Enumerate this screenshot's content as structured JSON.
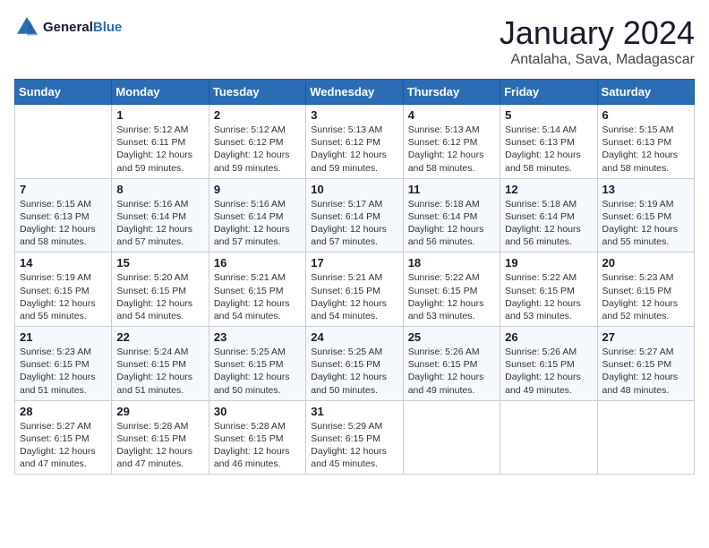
{
  "logo": {
    "line1": "General",
    "line2": "Blue"
  },
  "calendar": {
    "title": "January 2024",
    "subtitle": "Antalaha, Sava, Madagascar",
    "headers": [
      "Sunday",
      "Monday",
      "Tuesday",
      "Wednesday",
      "Thursday",
      "Friday",
      "Saturday"
    ],
    "weeks": [
      [
        {
          "day": "",
          "info": ""
        },
        {
          "day": "1",
          "info": "Sunrise: 5:12 AM\nSunset: 6:11 PM\nDaylight: 12 hours\nand 59 minutes."
        },
        {
          "day": "2",
          "info": "Sunrise: 5:12 AM\nSunset: 6:12 PM\nDaylight: 12 hours\nand 59 minutes."
        },
        {
          "day": "3",
          "info": "Sunrise: 5:13 AM\nSunset: 6:12 PM\nDaylight: 12 hours\nand 59 minutes."
        },
        {
          "day": "4",
          "info": "Sunrise: 5:13 AM\nSunset: 6:12 PM\nDaylight: 12 hours\nand 58 minutes."
        },
        {
          "day": "5",
          "info": "Sunrise: 5:14 AM\nSunset: 6:13 PM\nDaylight: 12 hours\nand 58 minutes."
        },
        {
          "day": "6",
          "info": "Sunrise: 5:15 AM\nSunset: 6:13 PM\nDaylight: 12 hours\nand 58 minutes."
        }
      ],
      [
        {
          "day": "7",
          "info": "Sunrise: 5:15 AM\nSunset: 6:13 PM\nDaylight: 12 hours\nand 58 minutes."
        },
        {
          "day": "8",
          "info": "Sunrise: 5:16 AM\nSunset: 6:14 PM\nDaylight: 12 hours\nand 57 minutes."
        },
        {
          "day": "9",
          "info": "Sunrise: 5:16 AM\nSunset: 6:14 PM\nDaylight: 12 hours\nand 57 minutes."
        },
        {
          "day": "10",
          "info": "Sunrise: 5:17 AM\nSunset: 6:14 PM\nDaylight: 12 hours\nand 57 minutes."
        },
        {
          "day": "11",
          "info": "Sunrise: 5:18 AM\nSunset: 6:14 PM\nDaylight: 12 hours\nand 56 minutes."
        },
        {
          "day": "12",
          "info": "Sunrise: 5:18 AM\nSunset: 6:14 PM\nDaylight: 12 hours\nand 56 minutes."
        },
        {
          "day": "13",
          "info": "Sunrise: 5:19 AM\nSunset: 6:15 PM\nDaylight: 12 hours\nand 55 minutes."
        }
      ],
      [
        {
          "day": "14",
          "info": "Sunrise: 5:19 AM\nSunset: 6:15 PM\nDaylight: 12 hours\nand 55 minutes."
        },
        {
          "day": "15",
          "info": "Sunrise: 5:20 AM\nSunset: 6:15 PM\nDaylight: 12 hours\nand 54 minutes."
        },
        {
          "day": "16",
          "info": "Sunrise: 5:21 AM\nSunset: 6:15 PM\nDaylight: 12 hours\nand 54 minutes."
        },
        {
          "day": "17",
          "info": "Sunrise: 5:21 AM\nSunset: 6:15 PM\nDaylight: 12 hours\nand 54 minutes."
        },
        {
          "day": "18",
          "info": "Sunrise: 5:22 AM\nSunset: 6:15 PM\nDaylight: 12 hours\nand 53 minutes."
        },
        {
          "day": "19",
          "info": "Sunrise: 5:22 AM\nSunset: 6:15 PM\nDaylight: 12 hours\nand 53 minutes."
        },
        {
          "day": "20",
          "info": "Sunrise: 5:23 AM\nSunset: 6:15 PM\nDaylight: 12 hours\nand 52 minutes."
        }
      ],
      [
        {
          "day": "21",
          "info": "Sunrise: 5:23 AM\nSunset: 6:15 PM\nDaylight: 12 hours\nand 51 minutes."
        },
        {
          "day": "22",
          "info": "Sunrise: 5:24 AM\nSunset: 6:15 PM\nDaylight: 12 hours\nand 51 minutes."
        },
        {
          "day": "23",
          "info": "Sunrise: 5:25 AM\nSunset: 6:15 PM\nDaylight: 12 hours\nand 50 minutes."
        },
        {
          "day": "24",
          "info": "Sunrise: 5:25 AM\nSunset: 6:15 PM\nDaylight: 12 hours\nand 50 minutes."
        },
        {
          "day": "25",
          "info": "Sunrise: 5:26 AM\nSunset: 6:15 PM\nDaylight: 12 hours\nand 49 minutes."
        },
        {
          "day": "26",
          "info": "Sunrise: 5:26 AM\nSunset: 6:15 PM\nDaylight: 12 hours\nand 49 minutes."
        },
        {
          "day": "27",
          "info": "Sunrise: 5:27 AM\nSunset: 6:15 PM\nDaylight: 12 hours\nand 48 minutes."
        }
      ],
      [
        {
          "day": "28",
          "info": "Sunrise: 5:27 AM\nSunset: 6:15 PM\nDaylight: 12 hours\nand 47 minutes."
        },
        {
          "day": "29",
          "info": "Sunrise: 5:28 AM\nSunset: 6:15 PM\nDaylight: 12 hours\nand 47 minutes."
        },
        {
          "day": "30",
          "info": "Sunrise: 5:28 AM\nSunset: 6:15 PM\nDaylight: 12 hours\nand 46 minutes."
        },
        {
          "day": "31",
          "info": "Sunrise: 5:29 AM\nSunset: 6:15 PM\nDaylight: 12 hours\nand 45 minutes."
        },
        {
          "day": "",
          "info": ""
        },
        {
          "day": "",
          "info": ""
        },
        {
          "day": "",
          "info": ""
        }
      ]
    ]
  }
}
